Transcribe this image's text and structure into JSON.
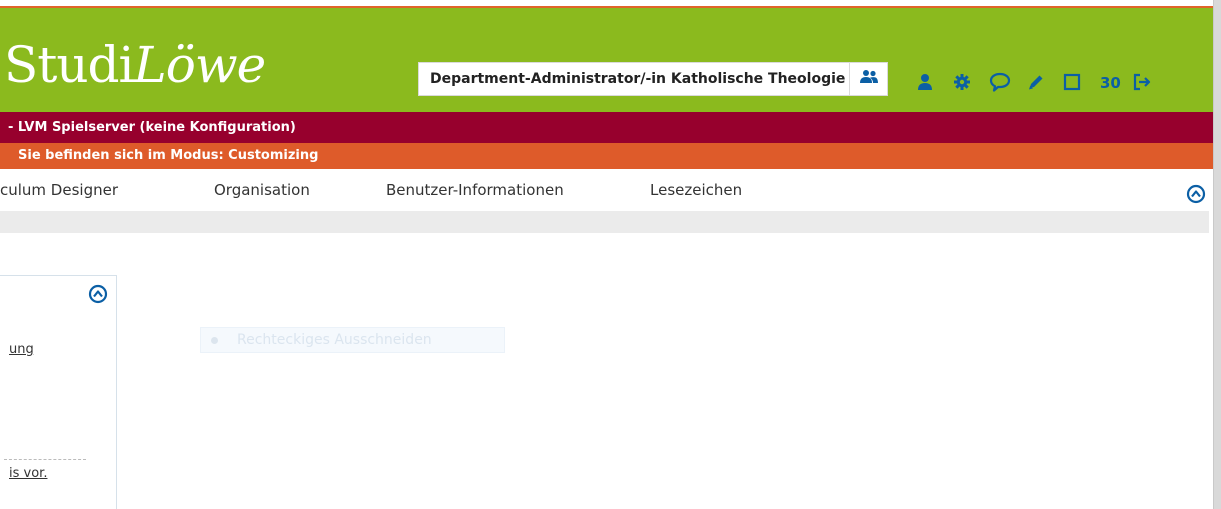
{
  "header": {
    "logo_regular": "Studi",
    "logo_italic": "Löwe",
    "role_value": "Department-Administrator/-in Katholische Theologie",
    "session_minutes": "30"
  },
  "bars": {
    "server": "- LVM Spielserver (keine Konfiguration)",
    "mode": "Sie befinden sich im Modus: Customizing"
  },
  "nav": {
    "items": [
      {
        "label": "culum Designer"
      },
      {
        "label": "Organisation"
      },
      {
        "label": "Benutzer-Informationen"
      },
      {
        "label": "Lesezeichen"
      }
    ]
  },
  "panel": {
    "link1": "ung",
    "link2": "is vor."
  },
  "overlay": {
    "label": "Rechteckiges Ausschneiden"
  },
  "icons": {
    "role_switch": "users-icon",
    "profile": "user-icon",
    "settings": "gear-icon",
    "messages": "chat-bubble-icon",
    "edit": "pencil-icon",
    "window": "square-icon",
    "logout": "logout-icon",
    "collapse": "chevron-up-circle-icon"
  },
  "colors": {
    "header_green": "#8bba1e",
    "server_bar": "#97002d",
    "mode_bar": "#de5b2a",
    "icon_blue": "#0b5fa5",
    "subbar_gray": "#ebebeb"
  }
}
